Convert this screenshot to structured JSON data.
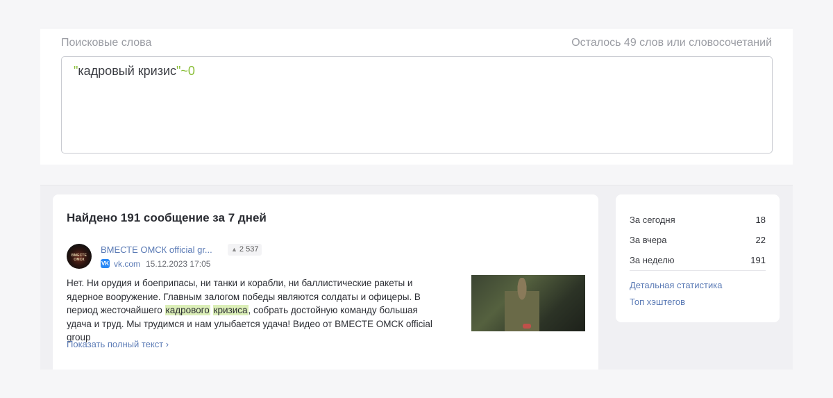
{
  "search": {
    "label": "Поисковые слова",
    "remaining": "Осталось 49 слов или словосочетаний",
    "query": {
      "open_quote": "\"",
      "phrase": "кадровый кризис",
      "close_quote": "\"",
      "operator": "~0"
    }
  },
  "results": {
    "title": "Найдено 191 сообщение за 7 дней",
    "post": {
      "avatar_text": "ВМЕСТЕ ОМСК",
      "author": "ВМЕСТЕ ОМСК official gr...",
      "reach": "2 537",
      "source_badge": "VK",
      "source": "vk.com",
      "date": "15.12.2023 17:05",
      "text_1": "Нет. Ни орудия и боеприпасы, ни танки и корабли, ни баллистические ракеты и ядерное вооружение. Главным залогом победы являются солдаты и офицеры. В период жесточайшего ",
      "highlight_1": "кадрового",
      "highlight_2": "кризиса",
      "text_2": ", собрать достойную команду большая удача и труд. Мы трудимся и нам улыбается удача! Видео от ВМЕСТЕ ОМСК official group",
      "show_more": "Показать полный текст ›"
    }
  },
  "stats": {
    "rows": [
      {
        "label": "За сегодня",
        "value": "18"
      },
      {
        "label": "За вчера",
        "value": "22"
      },
      {
        "label": "За неделю",
        "value": "191"
      }
    ],
    "links": {
      "detailed": "Детальная статистика",
      "hashtags": "Топ хэштегов"
    }
  },
  "colors": {
    "accent_link": "#5a7ab5",
    "highlight": "#dcefb8",
    "query_operator": "#8bbf3a"
  }
}
